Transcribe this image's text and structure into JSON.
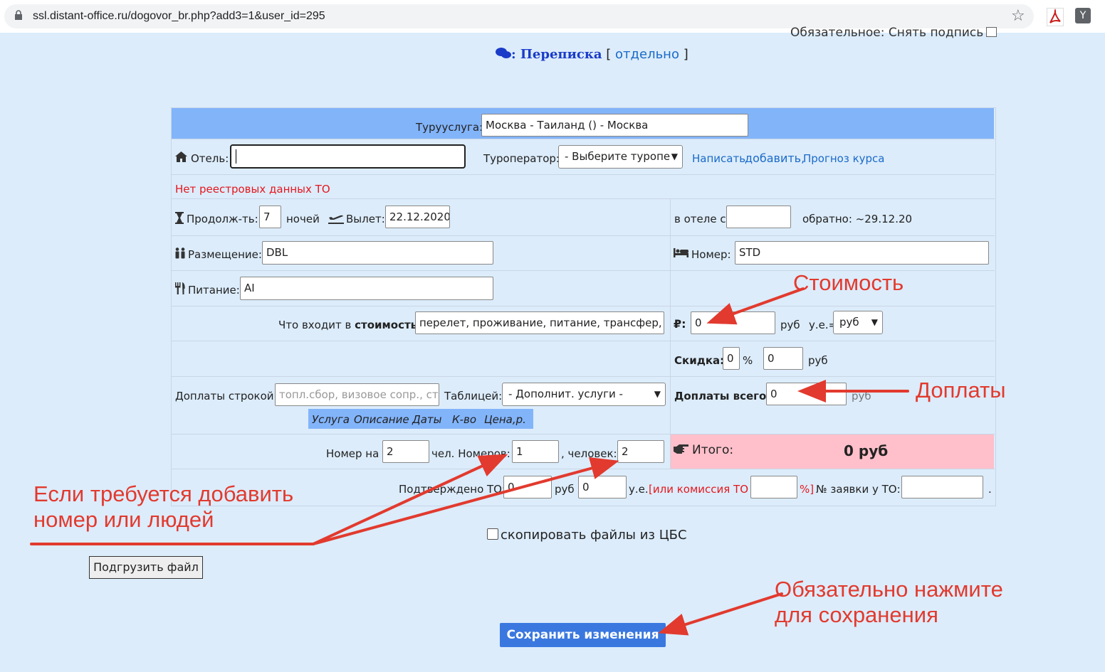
{
  "browser": {
    "url": "ssl.distant-office.ru/dogovor_br.php?add3=1&user_id=295"
  },
  "top": {
    "cut_text": "Обязательное: Снять подпись",
    "correspondence_label": ": Переписка",
    "separately_pre": "[",
    "separately_link": "отдельно",
    "separately_post": "]"
  },
  "form": {
    "tour_service_label": "Турууслуга:",
    "tour_service_value": "Москва - Таиланд () - Москва",
    "hotel_label": "Отель:",
    "hotel_value": "",
    "operator_label": "Туроператор:",
    "operator_select": "- Выберите туропе",
    "write_link": "Написать",
    "add_link": "добавить,",
    "forecast_link": "Прогноз курса",
    "no_registry": "Нет реестровых данных ТО",
    "duration_label": "Продолж-ть:",
    "duration_value": "7",
    "nights_label": "ночей",
    "departure_label": "Вылет:",
    "departure_value": "22.12.2020",
    "in_hotel_label": "в отеле с",
    "in_hotel_value": "",
    "return_label": "обратно: ~29.12.20",
    "placement_label": "Размещение:",
    "placement_value": "DBL",
    "room_label": "Номер:",
    "room_value": "STD",
    "meal_label": "Питание:",
    "meal_value": "AI",
    "includes_label_pre": "Что входит в",
    "includes_label_bold": "стоимость",
    "includes_label_post": ":",
    "includes_value": "перелет, проживание, питание, трансфер, ме,",
    "price_icon": "₽:",
    "price_value": "0",
    "rub_label": "руб",
    "currency_label": "у.е.=",
    "currency_select": "руб",
    "discount_label": "Скидка:",
    "discount_pct_value": "0",
    "pct_sign": "%",
    "discount_rub_value": "0",
    "discount_rub_label": "руб",
    "extra_line_label": "Доплаты строкой:",
    "extra_line_placeholder": "топл.сбор, визовое сопр., стра",
    "table_label": "Таблицей:",
    "table_select": "- Дополнит. услуги -",
    "extra_total_label": "Доплаты всего:",
    "extra_total_value": "0",
    "extra_total_unit": "руб",
    "services_headers": [
      "Услуга",
      "Описание",
      "Даты",
      "К-во",
      "Цена,р."
    ],
    "room_for_label": "Номер на",
    "room_for_value": "2",
    "rooms_label": "чел. Номеров:",
    "rooms_value": "1",
    "people_label": ", человек:",
    "people_value": "2",
    "total_label": "Итого:",
    "total_value": "0 руб",
    "confirmed_label": "Подтверждено ТО:",
    "confirmed_value": "0",
    "confirmed_rub": "руб",
    "confirmed_ue_value": "0",
    "ue_label": "у.е.",
    "commission_label": "[или комиссия ТО :",
    "commission_value": "",
    "commission_end": "%]",
    "order_label": "№ заявки у ТО:",
    "order_value": "",
    "order_end": "."
  },
  "copy_files_label": "скопировать файлы из ЦБС",
  "upload_button": "Подгрузить файл",
  "save_button": "Сохранить изменения",
  "annotations": {
    "cost": "Стоимость",
    "extras": "Доплаты",
    "add_room_line1": "Если требуется добавить",
    "add_room_line2": "номер или людей",
    "save_line1": "Обязательно нажмите",
    "save_line2": "для сохранения"
  },
  "colors": {
    "accent_blue": "#82b4fa",
    "annotation_red": "#e23a2e",
    "total_pink": "#ffc0cb",
    "save_blue": "#3a78e0"
  }
}
